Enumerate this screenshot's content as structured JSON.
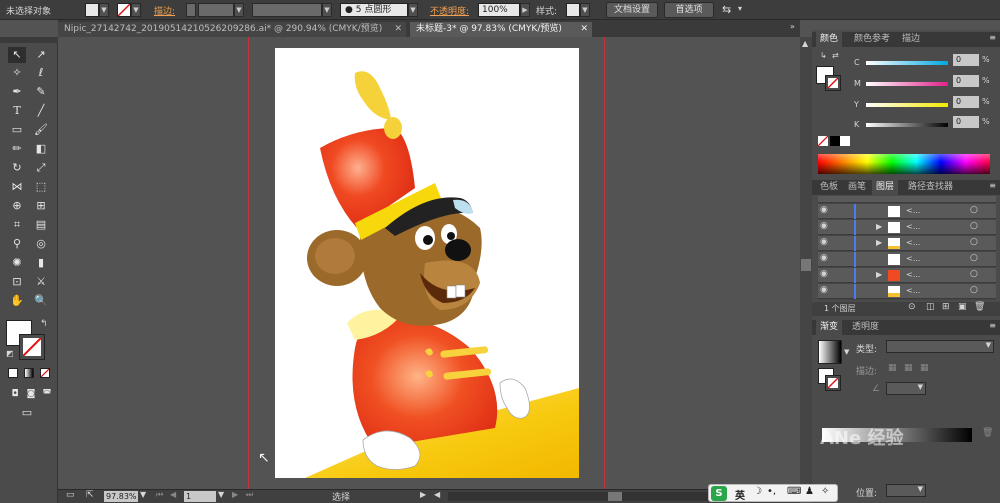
{
  "control_bar": {
    "selection_status": "未选择对象",
    "stroke_label": "描边:",
    "brush_label": "5 点圆形",
    "opacity_label": "不透明度:",
    "opacity_value": "100%",
    "style_label": "样式:",
    "doc_setup_button": "文档设置",
    "prefs_button": "首选项"
  },
  "tabs": [
    {
      "label": "Nipic_27142742_20190514210526209286.ai* @ 290.94% (CMYK/预览)",
      "active": false
    },
    {
      "label": "未标题-3* @ 97.83% (CMYK/预览)",
      "active": true
    }
  ],
  "status_bar": {
    "zoom": "97.83%",
    "page": "1",
    "tool_name": "选择"
  },
  "color_panel": {
    "tabs": [
      "颜色",
      "颜色参考",
      "描边"
    ],
    "channels": [
      {
        "label": "C",
        "value": "0"
      },
      {
        "label": "M",
        "value": "0"
      },
      {
        "label": "Y",
        "value": "0"
      },
      {
        "label": "K",
        "value": "0"
      }
    ]
  },
  "layers_panel": {
    "tabs": [
      "色板",
      "画笔",
      "图层",
      "路径查找器"
    ],
    "rows": [
      {
        "name": "<..."
      },
      {
        "name": "<..."
      },
      {
        "name": "<..."
      },
      {
        "name": "<..."
      },
      {
        "name": "<..."
      },
      {
        "name": "<..."
      }
    ],
    "footer_text": "1 个图层"
  },
  "gradient_panel": {
    "tabs": [
      "渐变",
      "透明度"
    ],
    "type_label": "类型:",
    "stroke_label": "描边:",
    "position_label": "位置:"
  },
  "watermark": {
    "text": "ANe 经验"
  },
  "taskbar": {
    "ime_label": "英"
  },
  "colors": {
    "ui_dark": "#3d3d3d",
    "canvas_bg": "#535353",
    "guide_red": "#c8323c",
    "hat_red": "#e8301c",
    "feather_yellow": "#f6d23a",
    "mouse_brown": "#9b6a2a",
    "floor_yellow": "#f7c90e"
  }
}
